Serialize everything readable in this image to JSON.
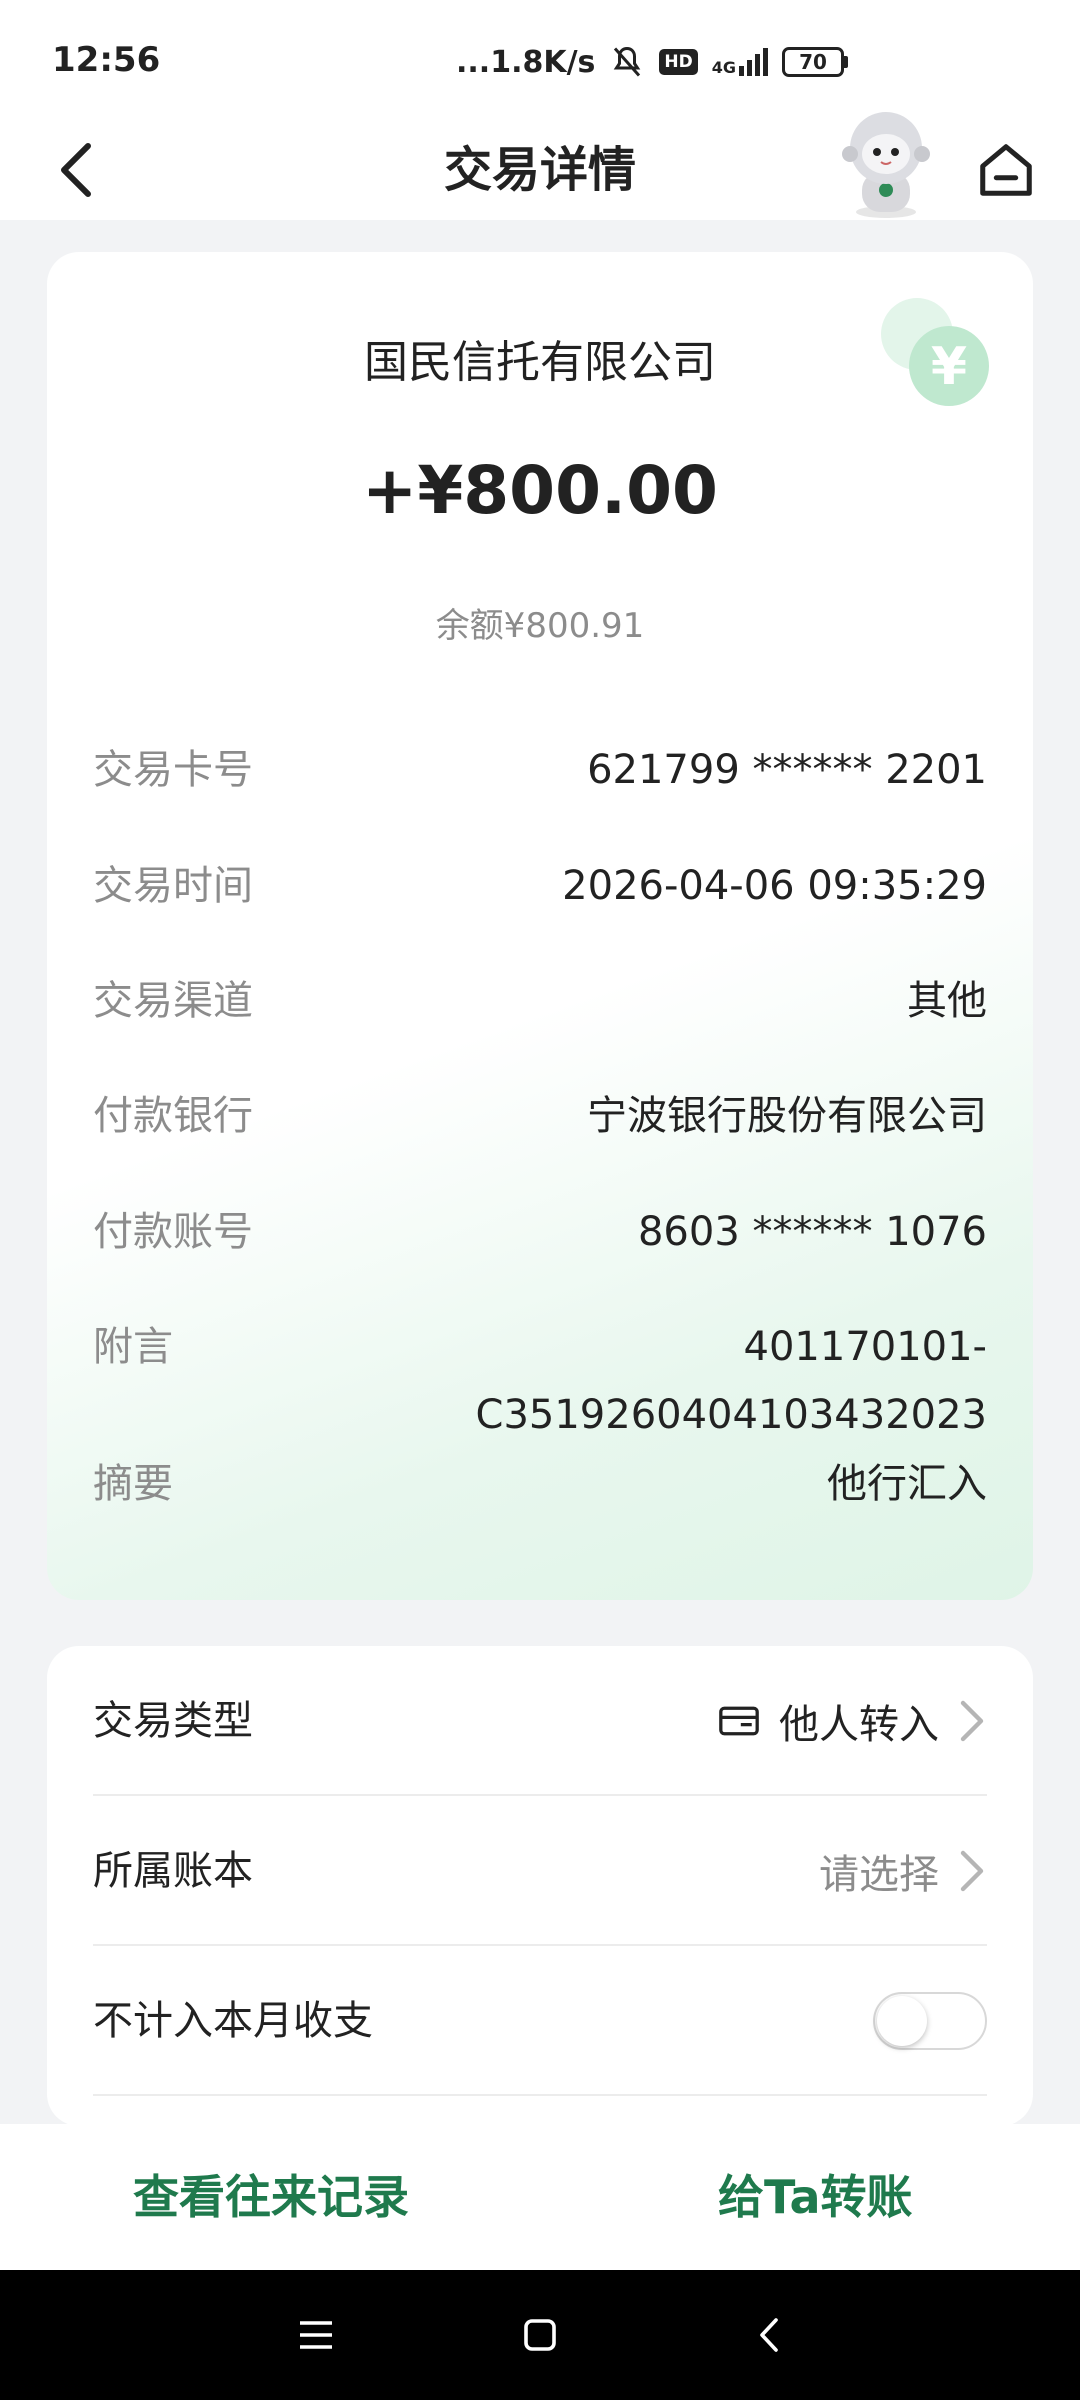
{
  "status_bar": {
    "time": "12:56",
    "network_speed": "...1.8K/s",
    "hd": "HD",
    "signal": "4G",
    "battery": "70"
  },
  "header": {
    "title": "交易详情"
  },
  "transaction": {
    "payer_name": "国民信托有限公司",
    "amount": "+¥800.00",
    "balance": "余额¥800.91",
    "details": [
      {
        "label": "交易卡号",
        "value": "621799 ****** 2201"
      },
      {
        "label": "交易时间",
        "value": "2026-04-06 09:35:29"
      },
      {
        "label": "交易渠道",
        "value": "其他"
      },
      {
        "label": "付款银行",
        "value": "宁波银行股份有限公司"
      },
      {
        "label": "付款账号",
        "value": "8603 ****** 1076"
      },
      {
        "label": "附言",
        "value_line1": "401170101-",
        "value_line2": "C351926040410343202​3"
      },
      {
        "label": "摘要",
        "value": "他行汇入"
      }
    ]
  },
  "settings": {
    "type_label": "交易类型",
    "type_value": "他人转入",
    "ledger_label": "所属账本",
    "ledger_value": "请选择",
    "exclude_label": "不计入本月收支",
    "exclude_on": false
  },
  "actions": {
    "history": "查看往来记录",
    "transfer": "给Ta转账"
  },
  "colors": {
    "accent": "#1f7a4d",
    "muted": "#8c8c8c",
    "deco_green": "#9fdcb6"
  }
}
